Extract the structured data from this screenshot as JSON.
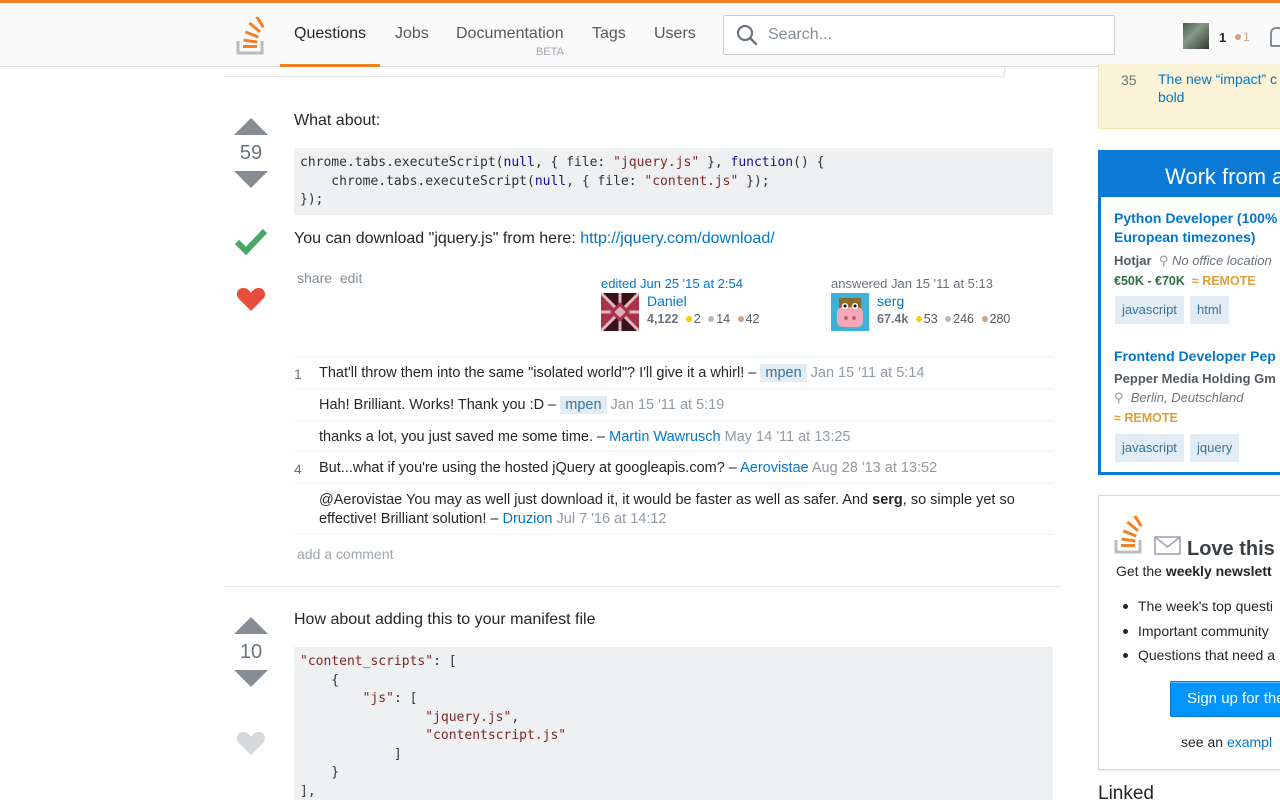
{
  "nav": {
    "items": [
      "Questions",
      "Jobs",
      "Documentation",
      "Tags",
      "Users"
    ],
    "documentation_badge": "BETA",
    "search_placeholder": "Search...",
    "user": {
      "reputation": "1",
      "bronze_badges": "1"
    }
  },
  "answer1": {
    "score": "59",
    "accepted": true,
    "favorited": true,
    "intro": "What about:",
    "code": [
      "chrome.tabs.executeScript(null, { file: \"jquery.js\" }, function() {",
      "    chrome.tabs.executeScript(null, { file: \"content.js\" });",
      "});"
    ],
    "download_text": "You can download \"jquery.js\" from here: ",
    "download_link": "http://jquery.com/download/",
    "menu": {
      "share": "share",
      "edit": "edit"
    },
    "edited": {
      "action": "edited Jun 25 '15 at 2:54",
      "name": "Daniel",
      "rep": "4,122",
      "gold": "2",
      "silver": "14",
      "bronze": "42"
    },
    "answered": {
      "action": "answered Jan 15 '11 at 5:13",
      "name": "serg",
      "rep": "67.4k",
      "gold": "53",
      "silver": "246",
      "bronze": "280"
    },
    "comments": [
      {
        "score": "1",
        "text": "That'll throw them into the same \"isolated world\"? I'll give it a whirl! – ",
        "user": "mpen",
        "op": true,
        "date": "Jan 15 '11 at 5:14"
      },
      {
        "score": "",
        "text": "Hah! Brilliant. Works! Thank you :D – ",
        "user": "mpen",
        "op": true,
        "date": "Jan 15 '11 at 5:19"
      },
      {
        "score": "",
        "text": "thanks a lot, you just saved me some time. – ",
        "user": "Martin Wawrusch",
        "op": false,
        "date": "May 14 '11 at 13:25"
      },
      {
        "score": "4",
        "text": "But...what if you're using the hosted jQuery at googleapis.com? – ",
        "user": "Aerovistae",
        "op": false,
        "date": "Aug 28 '13 at 13:52"
      },
      {
        "score": "",
        "text_before": "@Aerovistae You may as well just download it, it would be faster as well as safer. And ",
        "bold": "serg",
        "text_after": ", so simple yet so effective! Brilliant solution! – ",
        "user": "Druzion",
        "op": false,
        "date": "Jul 7 '16 at 14:12"
      }
    ],
    "add_comment": "add a comment"
  },
  "answer2": {
    "score": "10",
    "favorited": false,
    "intro": "How about adding this to your manifest file",
    "code": [
      "\"content_scripts\": [",
      "    {",
      "        \"js\": [",
      "                \"jquery.js\",",
      "                \"contentscript.js\"",
      "            ]",
      "    }",
      "],"
    ]
  },
  "sidebar": {
    "featured": {
      "count": "35",
      "text": "The new “impact” c\nbold"
    },
    "jobs": {
      "title": "Work from a",
      "listings": [
        {
          "title_line1": "Python Developer (100%",
          "title_line2": "European timezones)",
          "company": "Hotjar",
          "location": "No office location",
          "salary": "€50K - €70K",
          "remote": "REMOTE",
          "tags": [
            "javascript",
            "html"
          ]
        },
        {
          "title_line1": "Frontend Developer Pep",
          "company": "Pepper Media Holding Gm",
          "location": "Berlin, Deutschland",
          "remote": "REMOTE",
          "tags": [
            "javascript",
            "jquery"
          ]
        }
      ]
    },
    "newsletter": {
      "title": "Love this",
      "subtitle_pre": "Get the ",
      "subtitle_bold": "weekly newslett",
      "items": [
        "The week's top questi",
        "Important community",
        "Questions that need a"
      ],
      "button": "Sign up for the",
      "see_pre": "see an ",
      "see_link": "exampl"
    },
    "linked_title": "Linked"
  },
  "colors": {
    "accent": "#f48024",
    "link": "#0077cc",
    "accepted": "#48a868",
    "favorite": "#e74c3c",
    "jobs_blue": "#0a7ad6"
  }
}
